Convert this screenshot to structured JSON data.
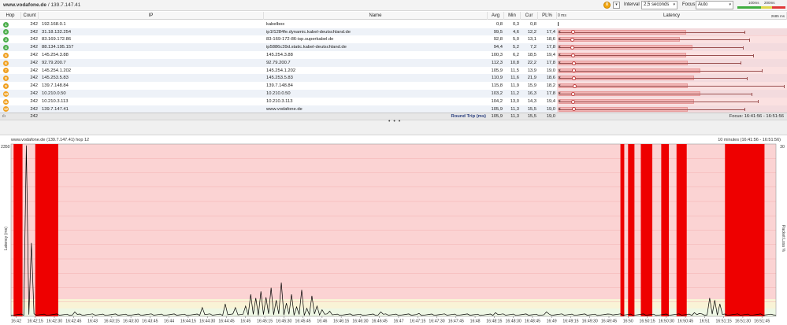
{
  "window": {
    "title_host": "www.vodafone.de",
    "title_ip": "139.7.147.41"
  },
  "toolbar": {
    "pause_icon": "pause-icon",
    "interval_label": "Interval",
    "interval_value": "2,5 seconds",
    "focus_label": "Focus",
    "focus_value": "Auto",
    "legend": {
      "ms100": "100ms",
      "ms200": "200ms",
      "green": "#3fae3f",
      "yellow": "#e0d84a",
      "red": "#e03a3a"
    }
  },
  "table": {
    "headers": {
      "hop": "Hop",
      "count": "Count",
      "ip": "IP",
      "name": "Name",
      "avg": "Avg",
      "min": "Min",
      "cur": "Cur",
      "pl": "PL%",
      "latency": "Latency",
      "lat_min": "0 ms",
      "lat_max": "2685 ms"
    },
    "rows": [
      {
        "hop": "1",
        "count": "242",
        "ip": "192.168.0.1",
        "name": "kabelbox",
        "avg": "0,8",
        "min": "0,3",
        "cur": "0,8",
        "pl": "",
        "dot": "#4cae4c",
        "avg_ms": 0.8,
        "max_ms": 5
      },
      {
        "hop": "2",
        "count": "242",
        "ip": "31.18.132.254",
        "name": "ip1f1284fe.dynamic.kabel-deutschland.de",
        "avg": "99,5",
        "min": "4,6",
        "cur": "12,2",
        "pl": "17,4",
        "dot": "#4cae4c",
        "avg_ms": 99.5,
        "max_ms": 2100
      },
      {
        "hop": "3",
        "count": "242",
        "ip": "83.169.172.86",
        "name": "83-169-172-86-isp.superkabel.de",
        "avg": "92,8",
        "min": "5,0",
        "cur": "13,1",
        "pl": "18,6",
        "dot": "#4cae4c",
        "avg_ms": 92.8,
        "max_ms": 2150
      },
      {
        "hop": "4",
        "count": "242",
        "ip": "88.134.195.157",
        "name": "ip5886c39d.static.kabel-deutschland.de",
        "avg": "94,4",
        "min": "5,2",
        "cur": "7,2",
        "pl": "17,8",
        "dot": "#4cae4c",
        "avg_ms": 94.4,
        "max_ms": 2080
      },
      {
        "hop": "5",
        "count": "242",
        "ip": "145.254.3.88",
        "name": "145.254.3.88",
        "avg": "100,3",
        "min": "6,2",
        "cur": "18,5",
        "pl": "19,4",
        "dot": "#f0a020",
        "avg_ms": 100.3,
        "max_ms": 2200
      },
      {
        "hop": "6",
        "count": "242",
        "ip": "92.79.200.7",
        "name": "92.79.200.7",
        "avg": "112,3",
        "min": "10,8",
        "cur": "22,2",
        "pl": "17,8",
        "dot": "#f0a020",
        "avg_ms": 112.3,
        "max_ms": 2050
      },
      {
        "hop": "7",
        "count": "242",
        "ip": "145.254.1.202",
        "name": "145.254.1.202",
        "avg": "105,9",
        "min": "11,5",
        "cur": "13,9",
        "pl": "19,0",
        "dot": "#f0a020",
        "avg_ms": 105.9,
        "max_ms": 2300
      },
      {
        "hop": "8",
        "count": "242",
        "ip": "145.253.5.83",
        "name": "145.253.5.83",
        "avg": "110,9",
        "min": "11,6",
        "cur": "21,9",
        "pl": "18,6",
        "dot": "#f0a020",
        "avg_ms": 110.9,
        "max_ms": 2120
      },
      {
        "hop": "9",
        "count": "242",
        "ip": "139.7.148.84",
        "name": "139.7.148.84",
        "avg": "115,8",
        "min": "11,9",
        "cur": "15,9",
        "pl": "18,2",
        "dot": "#f0a020",
        "avg_ms": 115.8,
        "max_ms": 2600
      },
      {
        "hop": "10",
        "count": "242",
        "ip": "10.210.0.50",
        "name": "10.210.0.50",
        "avg": "103,2",
        "min": "11,2",
        "cur": "16,3",
        "pl": "17,8",
        "dot": "#f0a020",
        "avg_ms": 103.2,
        "max_ms": 2180
      },
      {
        "hop": "11",
        "count": "242",
        "ip": "10.210.3.113",
        "name": "10.210.3.113",
        "avg": "104,2",
        "min": "13,0",
        "cur": "14,3",
        "pl": "19,4",
        "dot": "#f0a020",
        "avg_ms": 104.2,
        "max_ms": 2250
      },
      {
        "hop": "12",
        "count": "242",
        "ip": "139.7.147.41",
        "name": "www.vodafone.de",
        "avg": "105,9",
        "min": "11,3",
        "cur": "15,5",
        "pl": "19,0",
        "dot": "#f0a020",
        "avg_ms": 105.9,
        "max_ms": 2100
      }
    ],
    "summary": {
      "count": "242",
      "label": "Round Trip (ms)",
      "avg": "105,9",
      "min": "11,3",
      "cur": "15,5",
      "pl": "19,0",
      "focus": "Focus: 16:41:56 - 16:51:56"
    }
  },
  "graph": {
    "title": "www.vodafone.de (139.7.147.41) hop 12",
    "range": "10 minutes (16:41:56 - 16:51:56)",
    "ylabel_left": "Latency (ms)",
    "ylabel_right": "Packet Loss %",
    "y_top_left": "2350",
    "y_top_right": "30",
    "x_ticks": [
      "16:42",
      "16:42:15",
      "16:42:30",
      "16:42:45",
      "16:43",
      "16:43:15",
      "16:43:30",
      "16:43:45",
      "16:44",
      "16:44:15",
      "16:44:30",
      "16:44:45",
      "16:45",
      "16:45:15",
      "16:45:30",
      "16:45:45",
      "16:46",
      "16:46:15",
      "16:46:30",
      "16:46:45",
      "16:47",
      "16:47:15",
      "16:47:30",
      "16:47:45",
      "16:48",
      "16:48:15",
      "16:48:30",
      "16:48:45",
      "16:49",
      "16:49:15",
      "16:49:30",
      "16:49:45",
      "16:50",
      "16:50:15",
      "16:50:30",
      "16:50:45",
      "16:51",
      "16:51:15",
      "16:51:30",
      "16:51:45"
    ],
    "colors": {
      "bg_red": "#fbd3d3",
      "bg_green": "#eef7e4",
      "bg_yellow": "#f9f3d6",
      "loss": "#ee0000",
      "line": "#000000"
    }
  }
}
